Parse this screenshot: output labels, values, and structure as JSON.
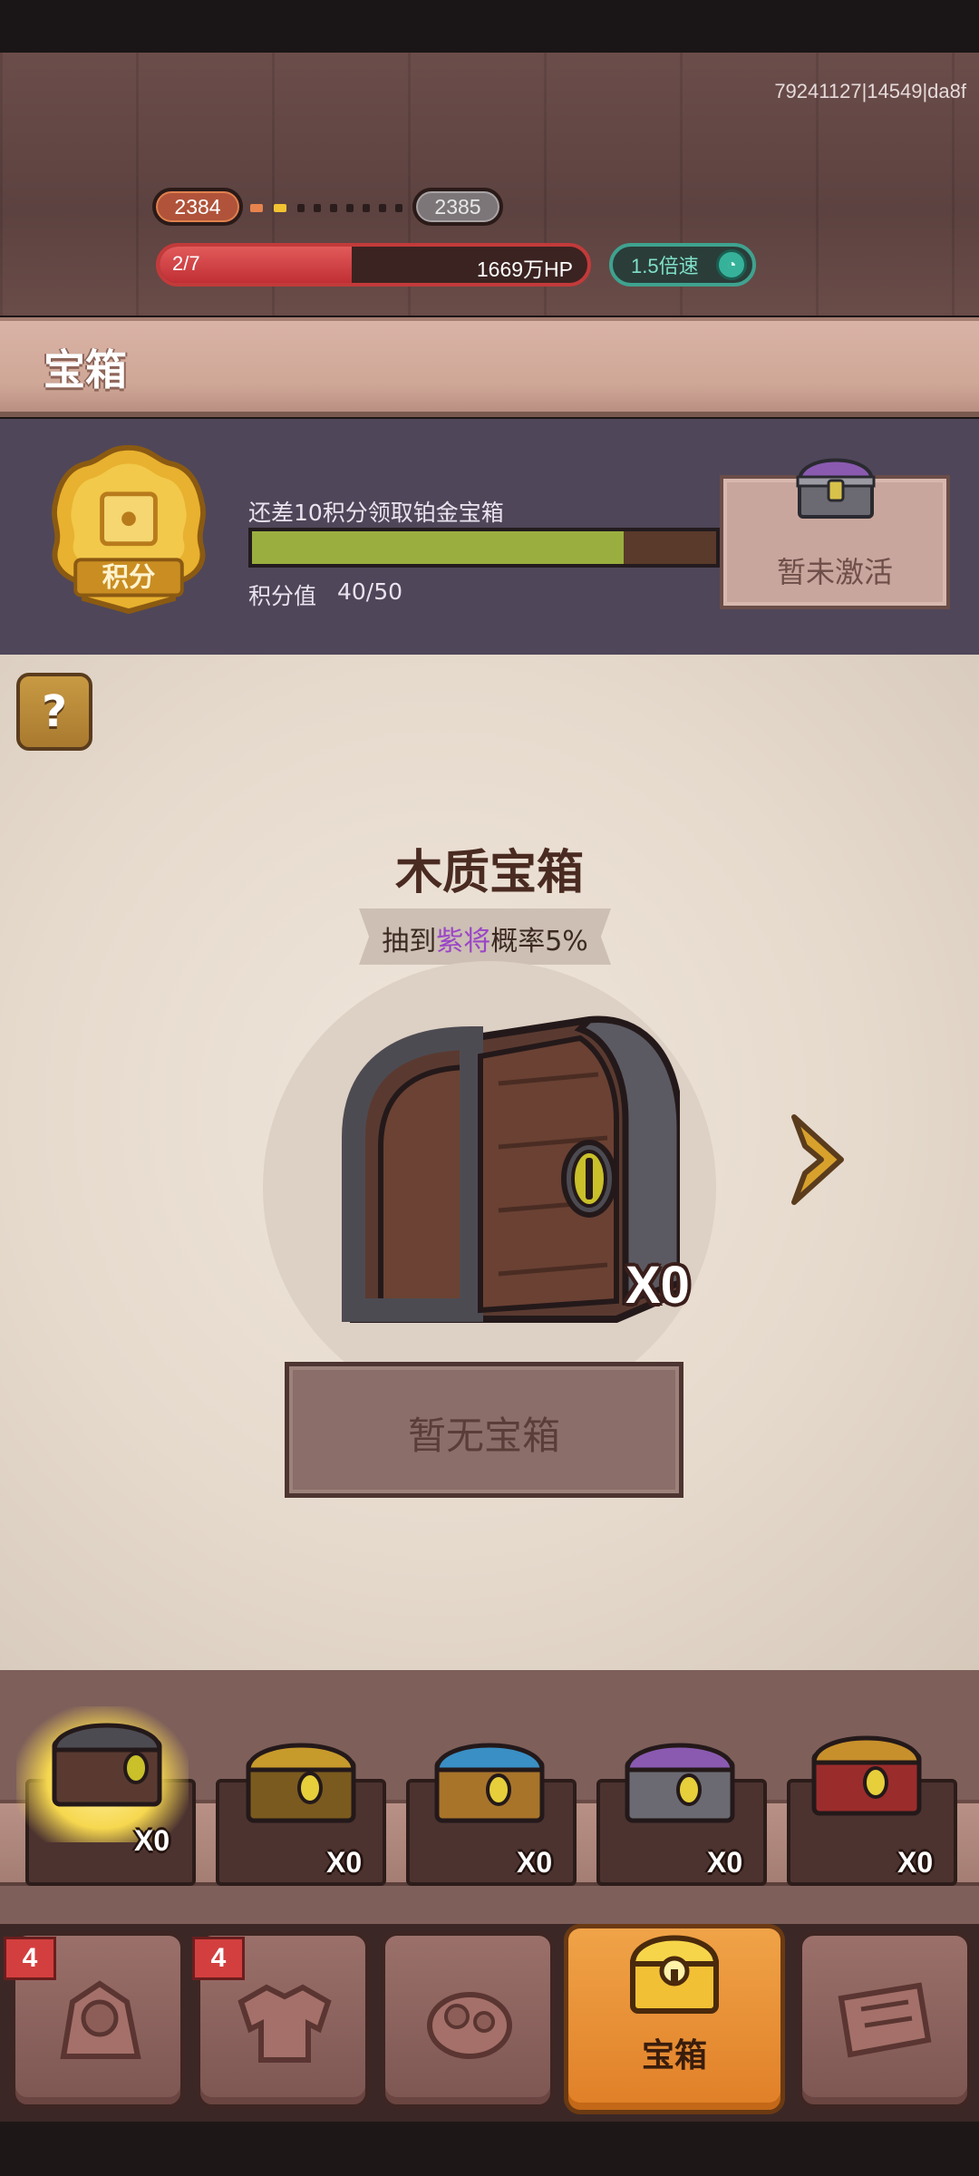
{
  "build_id": "79241127|14549|da8f",
  "stage": {
    "current_level": "2384",
    "next_level": "2385",
    "wave": "2/7",
    "boss_hp": "1669万HP",
    "hp_fraction": 0.45,
    "speed_label": "1.5倍速"
  },
  "page_title": "宝箱",
  "points": {
    "badge_label": "积分",
    "hint": "还差10积分领取铂金宝箱",
    "label": "积分值",
    "value": "40/50",
    "fraction": 0.8,
    "reward_status": "暂未激活"
  },
  "help_label": "?",
  "selected_chest": {
    "name": "木质宝箱",
    "odds_prefix": "抽到",
    "odds_highlight": "紫将",
    "odds_suffix": "概率5%",
    "count": "X0",
    "button_label": "暂无宝箱"
  },
  "chest_slots": [
    {
      "count": "X0",
      "selected": true
    },
    {
      "count": "X0",
      "selected": false
    },
    {
      "count": "X0",
      "selected": false
    },
    {
      "count": "X0",
      "selected": false
    },
    {
      "count": "X0",
      "selected": false
    }
  ],
  "nav": {
    "tab1_badge": "4",
    "tab2_badge": "4",
    "active_label": "宝箱"
  },
  "colors": {
    "accent_purple": "#9a46c7",
    "hp_red": "#c33a3a",
    "points_green": "#9aae3f",
    "active_tab_orange": "#e88f32"
  }
}
